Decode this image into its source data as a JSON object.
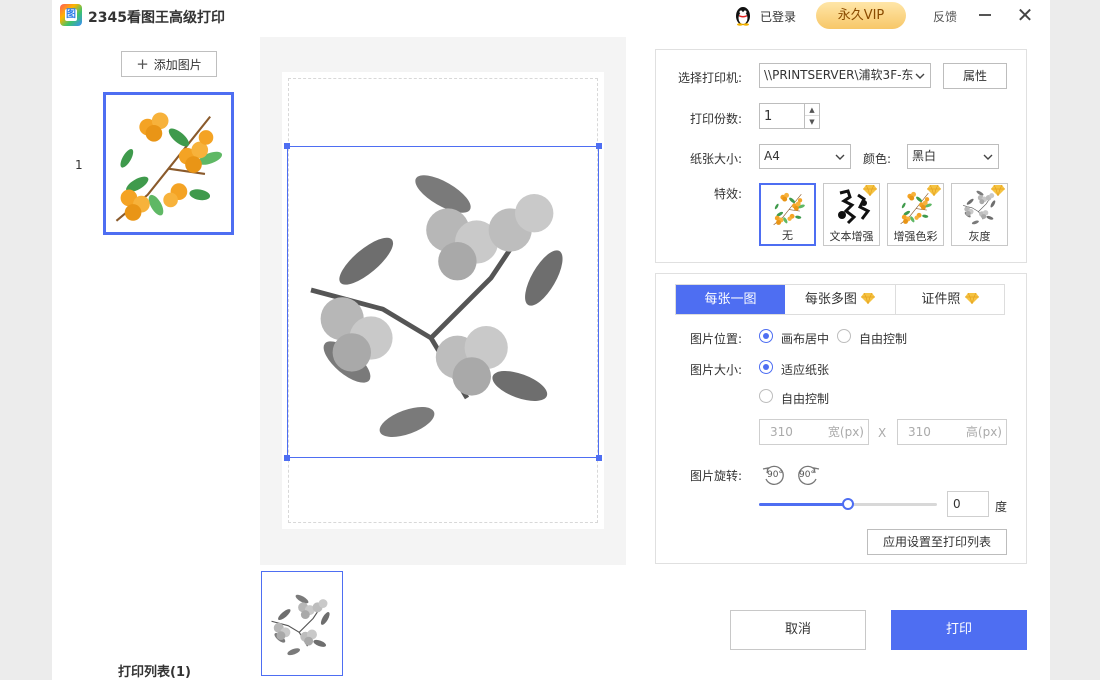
{
  "app": {
    "title": "2345看图王高级打印",
    "logo_glyph": "图",
    "login_status": "已登录",
    "vip_label": "永久VIP",
    "feedback_label": "反馈",
    "close_glyph": "✕"
  },
  "left_panel": {
    "add_image_label": "添加图片",
    "thumbnail_index": "1",
    "print_list_label": "打印列表(1)"
  },
  "printer": {
    "label": "选择打印机:",
    "value": "\\\\PRINTSERVER\\浦软3F-东",
    "properties_label": "属性"
  },
  "copies": {
    "label": "打印份数:",
    "value": "1"
  },
  "paper": {
    "label": "纸张大小:",
    "value": "A4",
    "color_label": "颜色:",
    "color_value": "黑白"
  },
  "effects": {
    "label": "特效:",
    "items": [
      {
        "label": "无",
        "active": true,
        "premium": false
      },
      {
        "label": "文本增强",
        "active": false,
        "premium": true
      },
      {
        "label": "增强色彩",
        "active": false,
        "premium": true
      },
      {
        "label": "灰度",
        "active": false,
        "premium": true
      }
    ]
  },
  "tabs": [
    {
      "label": "每张一图",
      "active": true,
      "premium": false
    },
    {
      "label": "每张多图",
      "active": false,
      "premium": true
    },
    {
      "label": "证件照",
      "active": false,
      "premium": true
    }
  ],
  "position": {
    "label": "图片位置:",
    "option_center": "画布居中",
    "option_free": "自由控制"
  },
  "size": {
    "label": "图片大小:",
    "option_fit": "适应纸张",
    "option_free": "自由控制",
    "width_value": "310",
    "width_unit": "宽(px)",
    "separator": "X",
    "height_value": "310",
    "height_unit": "高(px)"
  },
  "rotation": {
    "label": "图片旋转:",
    "rotate_left_label": "90°",
    "rotate_right_label": "90°",
    "slider_fraction": 0.5,
    "value": "0",
    "unit": "度"
  },
  "apply_label": "应用设置至打印列表",
  "footer": {
    "cancel_label": "取消",
    "print_label": "打印"
  },
  "colors": {
    "accent": "#4e6ef2",
    "vip_gold": "#f7c768",
    "fruit_orange": "#f4a324",
    "leaf_green": "#3f9a4c"
  },
  "icons": {
    "qq": "qq-penguin-icon",
    "diamond": "diamond-icon",
    "rotate_left": "rotate-left-icon",
    "rotate_right": "rotate-right-icon",
    "chevron": "chevron-down-icon",
    "plus": "plus-icon"
  }
}
